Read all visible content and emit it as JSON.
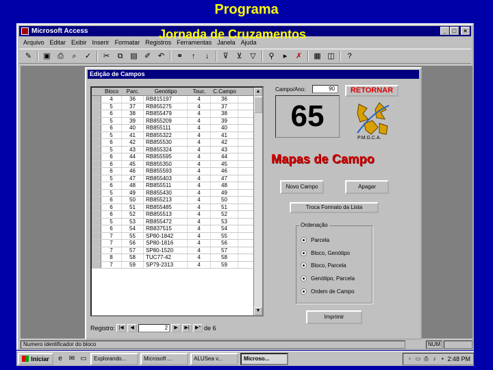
{
  "slide": {
    "title": "Programa",
    "subtitle": "Jornada de Cruzamentos"
  },
  "access": {
    "title": "Microsoft Access",
    "menu": [
      "Arquivo",
      "Editar",
      "Exibir",
      "Inserir",
      "Formatar",
      "Registros",
      "Ferramentas",
      "Janela",
      "Ajuda"
    ],
    "window_buttons": [
      "_",
      "□",
      "×"
    ]
  },
  "form": {
    "title": "Edição de Campos",
    "columns": [
      "Bloco",
      "Parc.",
      "Genótipo",
      "Touc.",
      "C.Campo"
    ],
    "rows": [
      [
        "4",
        "36",
        "RB815197",
        "4",
        "36"
      ],
      [
        "5",
        "37",
        "RB855275",
        "4",
        "37"
      ],
      [
        "6",
        "38",
        "RB855479",
        "4",
        "38"
      ],
      [
        "5",
        "39",
        "RB855209",
        "4",
        "39"
      ],
      [
        "6",
        "40",
        "RB855111",
        "4",
        "40"
      ],
      [
        "5",
        "41",
        "RB855322",
        "4",
        "41"
      ],
      [
        "6",
        "42",
        "RB855530",
        "4",
        "42"
      ],
      [
        "5",
        "43",
        "RB855324",
        "4",
        "43"
      ],
      [
        "6",
        "44",
        "RB855595",
        "4",
        "44"
      ],
      [
        "6",
        "45",
        "RB855350",
        "4",
        "45"
      ],
      [
        "6",
        "46",
        "RB855593",
        "4",
        "46"
      ],
      [
        "5",
        "47",
        "RB855403",
        "4",
        "47"
      ],
      [
        "6",
        "48",
        "RB855511",
        "4",
        "48"
      ],
      [
        "5",
        "49",
        "RB855430",
        "4",
        "49"
      ],
      [
        "6",
        "50",
        "RB855213",
        "4",
        "50"
      ],
      [
        "6",
        "51",
        "RB855485",
        "4",
        "51"
      ],
      [
        "6",
        "52",
        "RB855513",
        "4",
        "52"
      ],
      [
        "5",
        "53",
        "RB855472",
        "4",
        "53"
      ],
      [
        "6",
        "54",
        "RB837515",
        "4",
        "54"
      ],
      [
        "7",
        "55",
        "SP80-1842",
        "4",
        "55"
      ],
      [
        "7",
        "56",
        "SP80-1816",
        "4",
        "56"
      ],
      [
        "7",
        "57",
        "SP80-1520",
        "4",
        "57"
      ],
      [
        "8",
        "58",
        "TUC77-42",
        "4",
        "58"
      ],
      [
        "7",
        "59",
        "SP79-2313",
        "4",
        "59"
      ]
    ],
    "nav": {
      "label": "Registro:",
      "record": "2",
      "of_label": "de 6"
    },
    "campo_label": "Campo/Ano:",
    "campo_value": "90",
    "retornar_label": "RETORNAR",
    "big_number": "65",
    "logo_text": "P.M.G.C.A.",
    "mapas_title": "Mapas de Campo",
    "novo_campo_label": "Novo Campo",
    "apagar_label": "Apagar",
    "troca_label": "Troca Formato da Lista",
    "ordenacao_label": "Ordenação",
    "ordenacao_options": [
      "Parcela",
      "Bloco, Genótipo",
      "Bloco, Parcela",
      "Genótipo, Parcela",
      "Ordem de Campo"
    ],
    "imprimir_label": "Imprimir"
  },
  "status": {
    "text": "Numero identificador do bloco",
    "indicator": "NUM"
  },
  "taskbar": {
    "start_label": "Iniciar",
    "tasks": [
      "Explorando...",
      "Microsoft ...",
      "ALUSea v...",
      "Microso..."
    ],
    "clock": "2:48 PM"
  },
  "colors": {
    "desktop": "#0000a8",
    "title_text": "#ffff00",
    "accent_red": "#d00000",
    "window_face": "#c0c0c0"
  }
}
